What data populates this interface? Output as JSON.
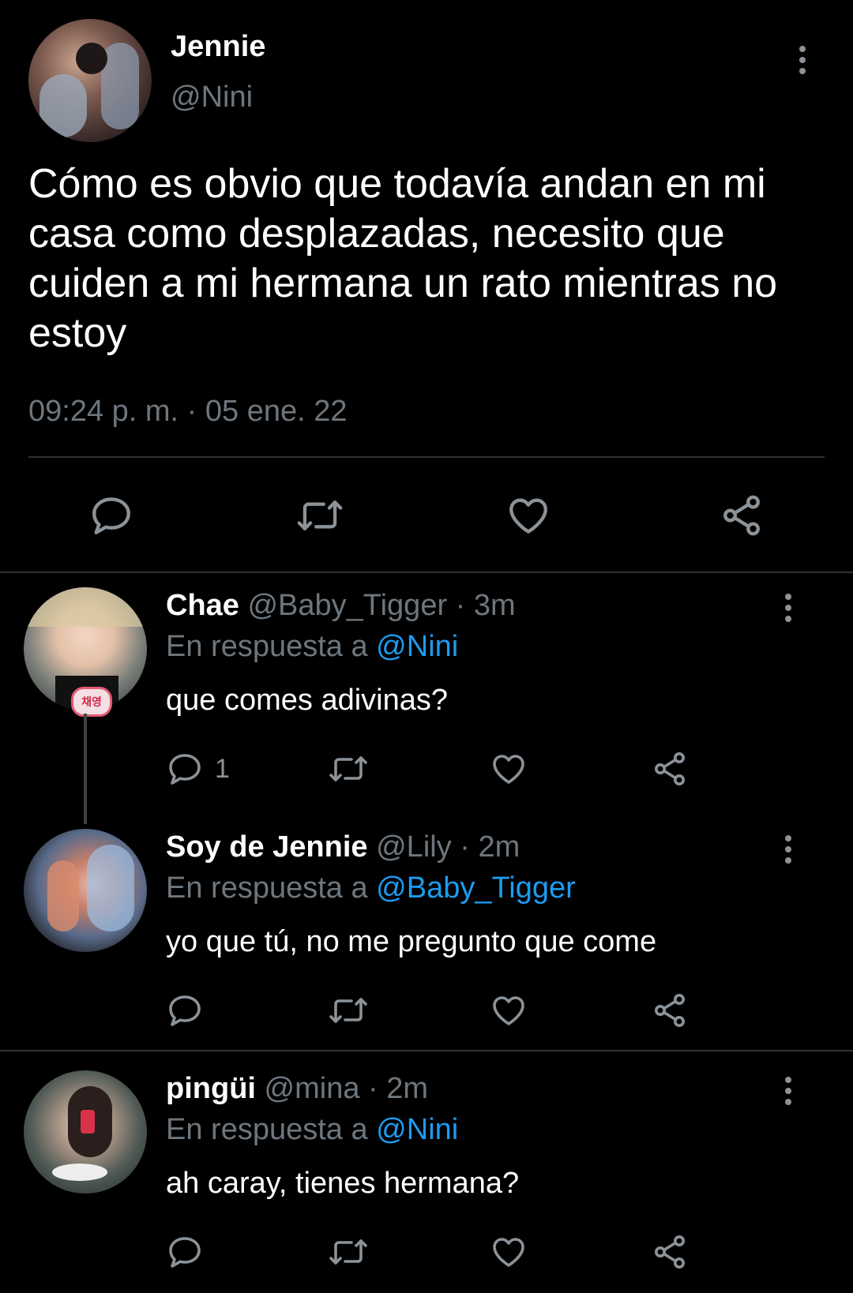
{
  "main_tweet": {
    "display_name": "Jennie",
    "handle": "@Nini",
    "text": "Cómo es obvio que todavía andan en mi casa como desplazadas, necesito que cuiden a mi hermana un rato mientras no estoy",
    "timestamp": "09:24 p. m. · 05 ene. 22",
    "actions": [
      "reply-icon",
      "retweet-icon",
      "like-icon",
      "share-icon"
    ]
  },
  "replies": [
    {
      "display_name": "Chae",
      "meta": "@Baby_Tigger · 3m",
      "reply_prefix": "En respuesta a",
      "reply_to": "@Nini",
      "text": "que comes adivinas?",
      "reply_count": "1",
      "avatar_badge": "채영"
    },
    {
      "display_name": "Soy de Jennie",
      "meta": "@Lily · 2m",
      "reply_prefix": "En respuesta a",
      "reply_to": "@Baby_Tigger",
      "text": "yo que tú, no me pregunto que come",
      "reply_count": ""
    },
    {
      "display_name": "pingüi",
      "meta": "@mina · 2m",
      "reply_prefix": "En respuesta a",
      "reply_to": "@Nini",
      "text": "ah caray, tienes hermana?",
      "reply_count": ""
    }
  ],
  "colors": {
    "background": "#000000",
    "muted": "#6e767d",
    "link": "#1d9bf0",
    "divider": "#2f3336"
  }
}
